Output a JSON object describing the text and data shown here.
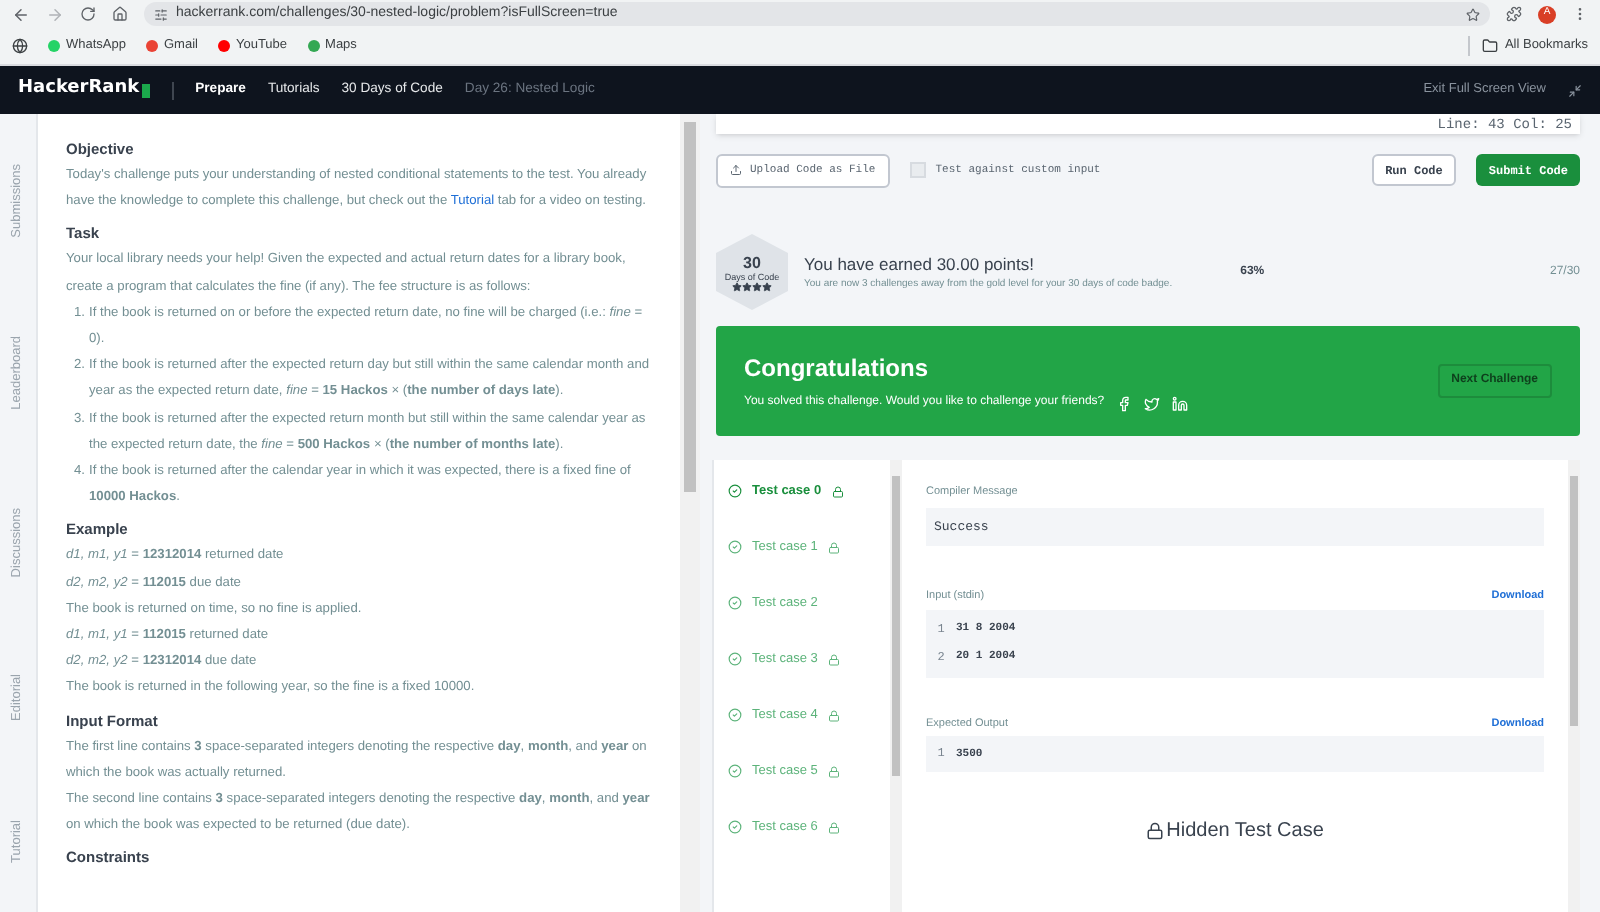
{
  "browser": {
    "url": "hackerrank.com/challenges/30-nested-logic/problem?isFullScreen=true",
    "bookmarks": [
      "WhatsApp",
      "Gmail",
      "YouTube",
      "Maps"
    ],
    "all_bookmarks": "All Bookmarks",
    "profile": "A"
  },
  "nav": {
    "logo": "HackerRank",
    "links": [
      {
        "label": "Prepare",
        "selected": true
      },
      {
        "label": "Tutorials",
        "selected": false
      },
      {
        "label": "30 Days of Code",
        "selected": false
      }
    ],
    "breadcrumb": "Day 26: Nested Logic",
    "exit": "Exit Full Screen View"
  },
  "side_tabs": [
    "Submissions",
    "Leaderboard",
    "Discussions",
    "Editorial",
    "Tutorial"
  ],
  "problem": [
    {
      "kind": "heading",
      "text": "Objective"
    },
    {
      "kind": "para",
      "text": "Today's challenge puts your understanding of nested conditional statements to the test. You already have the knowledge to complete this challenge, but check out the ",
      "link": "Tutorial",
      "after": " tab for a video on testing."
    },
    {
      "kind": "heading",
      "text": "Task"
    },
    {
      "kind": "para",
      "text": "Your local library needs your help! Given the expected and actual return dates for a library book, create a program that calculates the fine (if any). The fee structure is as follows:"
    },
    {
      "kind": "list",
      "items": [
        {
          "number": "1.",
          "text": "If the book is returned on or before the expected return date, no fine will be charged (i.e.: *fine* = 0)."
        },
        {
          "number": "2.",
          "text": "If the book is returned after the expected return day but still within the same calendar month and year as the expected return date, *fine* = **15 Hackos** × (**the number of days late**)."
        },
        {
          "number": "3.",
          "text": "If the book is returned after the expected return month but still within the same calendar year as the expected return date, the *fine* = **500 Hackos** × (**the number of months late**)."
        },
        {
          "number": "4.",
          "text": "If the book is returned after the calendar year in which it was expected, there is a fixed fine of **10000 Hackos**."
        }
      ]
    },
    {
      "kind": "heading",
      "text": "Example"
    },
    {
      "kind": "para",
      "text": "*d1, m1, y1* = **12312014** returned date"
    },
    {
      "kind": "para",
      "text": "*d2, m2, y2* = **112015** due date"
    },
    {
      "kind": "para",
      "text": "The book is returned on time, so no fine is applied."
    },
    {
      "kind": "para",
      "text": "*d1, m1, y1* = **112015** returned date"
    },
    {
      "kind": "para",
      "text": "*d2, m2, y2* = **12312014** due date"
    },
    {
      "kind": "para",
      "text": "The book is returned in the following year, so the fine is a fixed 10000."
    },
    {
      "kind": "heading",
      "text": "Input Format"
    },
    {
      "kind": "para",
      "text": "The first line contains **3** space-separated integers denoting the respective **day**, **month**, and **year** on which the book was actually returned."
    },
    {
      "kind": "para",
      "text": "The second line contains **3** space-separated integers denoting the respective **day**, **month**, and **year** on which the book was expected to be returned (due date)."
    },
    {
      "kind": "heading",
      "text": "Constraints"
    }
  ],
  "editor": {
    "cursor": "Line: 43 Col: 25",
    "upload": "Upload Code as File",
    "custom_input": {
      "label": "Test against custom input",
      "checked": false
    },
    "run": "Run Code",
    "submit": "Submit Code"
  },
  "badge": {
    "number": "30",
    "label": "Days of Code",
    "stars": 4,
    "title": "You have earned 30.00 points!",
    "subtitle": "You are now 3 challenges away from the gold level for your 30 days of code badge.",
    "percent": "63%",
    "count": "27/30"
  },
  "congrats": {
    "title": "Congratulations",
    "text": "You solved this challenge. Would you like to challenge your friends?",
    "next": "Next Challenge"
  },
  "test_cases": [
    {
      "label": "Test case 0",
      "selected": true,
      "locked": true
    },
    {
      "label": "Test case 1",
      "selected": false,
      "locked": true
    },
    {
      "label": "Test case 2",
      "selected": false,
      "locked": false
    },
    {
      "label": "Test case 3",
      "selected": false,
      "locked": true
    },
    {
      "label": "Test case 4",
      "selected": false,
      "locked": true
    },
    {
      "label": "Test case 5",
      "selected": false,
      "locked": true
    },
    {
      "label": "Test case 6",
      "selected": false,
      "locked": true
    }
  ],
  "result": {
    "compiler_label": "Compiler Message",
    "compiler_message": "Success",
    "input_label": "Input (stdin)",
    "input_download": "Download",
    "input_lines": [
      {
        "number": "1",
        "text": "31 8 2004"
      },
      {
        "number": "2",
        "text": "20 1 2004"
      }
    ],
    "output_label": "Expected Output",
    "output_download": "Download",
    "output_lines": [
      {
        "number": "1",
        "text": "3500"
      }
    ],
    "hidden": "Hidden Test Case"
  }
}
